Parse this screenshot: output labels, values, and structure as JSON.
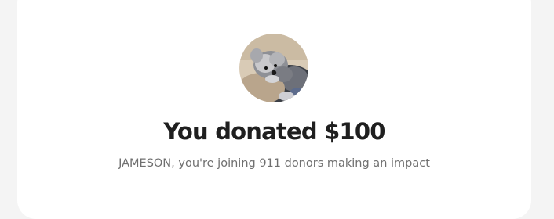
{
  "donation": {
    "avatar_alt": "dog photo",
    "title": "You donated $100",
    "message": "JAMESON, you're joining 911 donors making an impact"
  },
  "colors": {
    "background": "#f4f4f4",
    "card": "#ffffff",
    "title": "#1f1f1f",
    "subtitle": "#6f6f6f"
  }
}
